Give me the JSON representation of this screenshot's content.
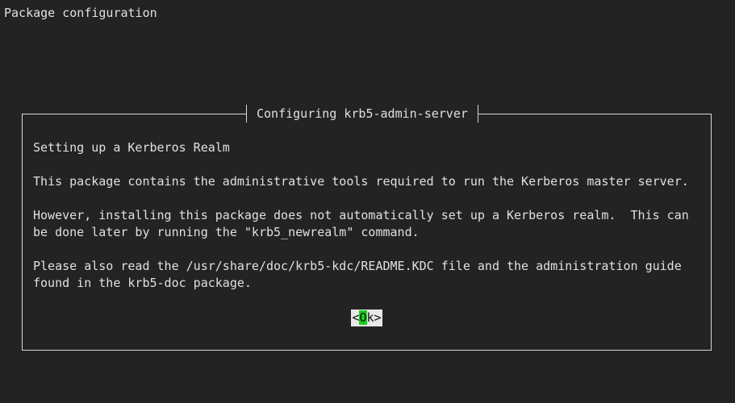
{
  "window": {
    "title": "Package configuration"
  },
  "dialog": {
    "title": "Configuring krb5-admin-server",
    "paragraphs": [
      "Setting up a Kerberos Realm",
      "This package contains the administrative tools required to run the Kerberos master server.",
      "However, installing this package does not automatically set up a Kerberos realm.  This can be done later by running the \"krb5_newrealm\" command.",
      "Please also read the /usr/share/doc/krb5-kdc/README.KDC file and the administration guide found in the krb5-doc package."
    ],
    "ok_button": {
      "open_bracket": "<",
      "hotkey": "O",
      "rest": "k",
      "close_bracket": ">"
    }
  },
  "colors": {
    "background": "#232323",
    "text": "#e0e0e0",
    "border": "#d8d8d8",
    "button_bg": "#e8e8e8",
    "hotkey_bg": "#19d219"
  }
}
